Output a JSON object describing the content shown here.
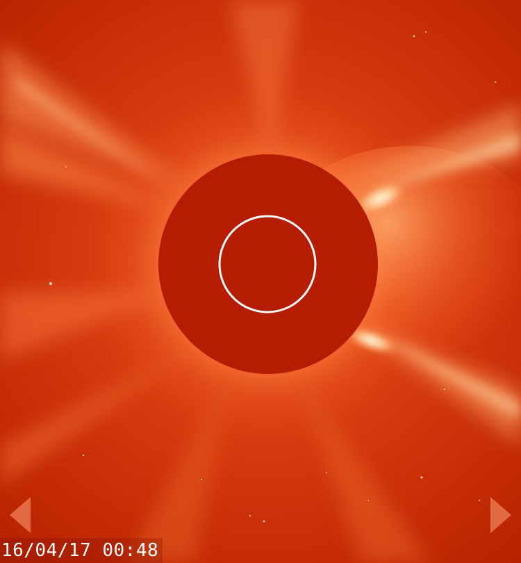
{
  "viewer": {
    "timestamp": "16/04/17 00:48"
  },
  "icons": {
    "prev": "chevron-left-icon",
    "next": "chevron-right-icon"
  },
  "colors": {
    "background": "#c42a06",
    "occulter": "#b51c00",
    "sun_outline": "#ffffff",
    "bright_streamer": "#fff0c8",
    "arrow": "#e8774e"
  }
}
